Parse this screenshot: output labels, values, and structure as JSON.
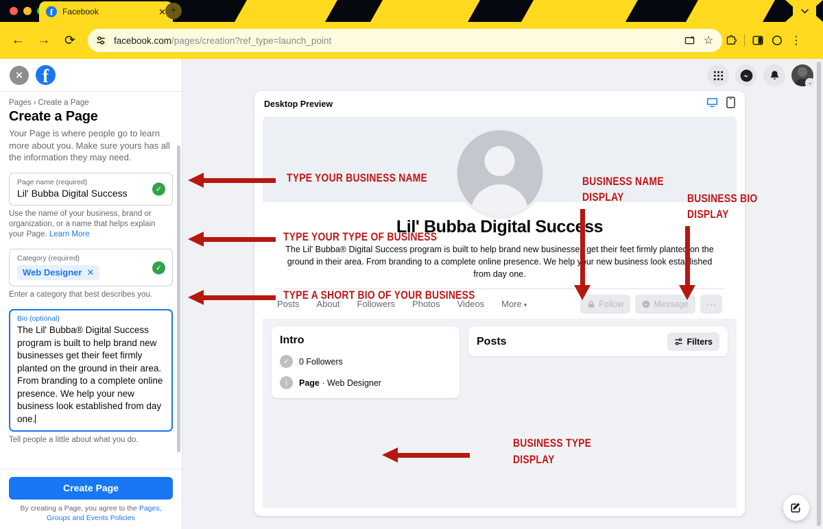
{
  "browser": {
    "tab": {
      "title": "Facebook",
      "favicon": "facebook-icon",
      "close": "✕"
    },
    "new_tab": "+",
    "window_chevron": "⌄",
    "nav": {
      "back": "←",
      "forward": "→",
      "reload": "⟳"
    },
    "omnibox": {
      "site_settings_icon": "tune-icon",
      "url_domain": "facebook.com",
      "url_path": "/pages/creation?ref_type=launch_point",
      "cast_icon": "⎘",
      "bookmark_icon": "☆"
    },
    "toolbar_right": {
      "extensions_icon": "puzzle-icon",
      "side_panel_icon": "◨",
      "profile_icon": "○",
      "menu_icon": "⋮"
    },
    "accent_yellow": "#ffda1f",
    "accent_dark": "#06080f"
  },
  "sidebar": {
    "close_label": "✕",
    "logo_letter": "f",
    "breadcrumb": {
      "root": "Pages",
      "sep": "›",
      "current": "Create a Page"
    },
    "title": "Create a Page",
    "description": "Your Page is where people go to learn more about you. Make sure yours has all the information they may need.",
    "fields": {
      "page_name": {
        "label": "Page name (required)",
        "value": "Lil' Bubba Digital Success",
        "valid_icon": "✓",
        "helper": "Use the name of your business, brand or organization, or a name that helps explain your Page.",
        "helper_link": "Learn More"
      },
      "category": {
        "label": "Category (required)",
        "chip": "Web Designer",
        "chip_remove": "✕",
        "valid_icon": "✓",
        "helper": "Enter a category that best describes you."
      },
      "bio": {
        "label": "Bio (optional)",
        "value": "The Lil' Bubba® Digital Success program is built to help brand new businesses get their feet firmly planted on the ground in their area. From branding to a complete online presence. We help your new business look established from day one.",
        "helper": "Tell people a little about what you do."
      }
    },
    "footer": {
      "create_button": "Create Page",
      "terms_prefix": "By creating a Page, you agree to the ",
      "terms_link": "Pages, Groups and Events Policies"
    },
    "accent_blue": "#1877f2",
    "valid_green": "#31a24c"
  },
  "topbar": {
    "menu_icon": "grid-icon",
    "messenger_icon": "messenger-icon",
    "notifications_icon": "bell-icon",
    "account_icon": "avatar",
    "account_caret": "⌄"
  },
  "preview": {
    "header_title": "Desktop Preview",
    "desktop_icon": "monitor-icon",
    "mobile_icon": "phone-icon",
    "active_device": "desktop",
    "page": {
      "name": "Lil' Bubba Digital Success",
      "bio": "The Lil' Bubba® Digital Success program is built to help brand new businesses get their feet firmly planted on the ground in their area. From branding to a complete online presence. We help your new business look established from day one.",
      "tabs": [
        "Posts",
        "About",
        "Followers",
        "Photos",
        "Videos"
      ],
      "more_tab": "More",
      "more_caret": "▾",
      "actions": {
        "follow": "Follow",
        "message": "Message",
        "more": "⋯"
      },
      "intro": {
        "title": "Intro",
        "followers": "0 Followers",
        "page_type_bold": "Page",
        "page_type_rest": " · Web Designer"
      },
      "posts": {
        "title": "Posts",
        "filters": "Filters",
        "filters_icon": "sliders-icon"
      }
    }
  },
  "fab": {
    "icon": "compose-icon"
  },
  "annotations": {
    "color": "#c01616",
    "items": [
      {
        "id": "type-business-name",
        "text": "TYPE YOUR BUSINESS NAME",
        "direction": "left"
      },
      {
        "id": "type-type-of-business",
        "text": "TYPE YOUR TYPE OF BUSINESS",
        "direction": "left"
      },
      {
        "id": "type-short-bio",
        "text": "TYPE A SHORT BIO OF YOUR BUSINESS",
        "direction": "left"
      },
      {
        "id": "business-name-display",
        "text_line1": "BUSINESS NAME",
        "text_line2": "DISPLAY",
        "direction": "down"
      },
      {
        "id": "business-bio-display",
        "text_line1": "BUSINESS BIO",
        "text_line2": "DISPLAY",
        "direction": "down"
      },
      {
        "id": "business-type-display",
        "text_line1": "BUSINESS TYPE",
        "text_line2": "DISPLAY",
        "direction": "left"
      }
    ]
  }
}
